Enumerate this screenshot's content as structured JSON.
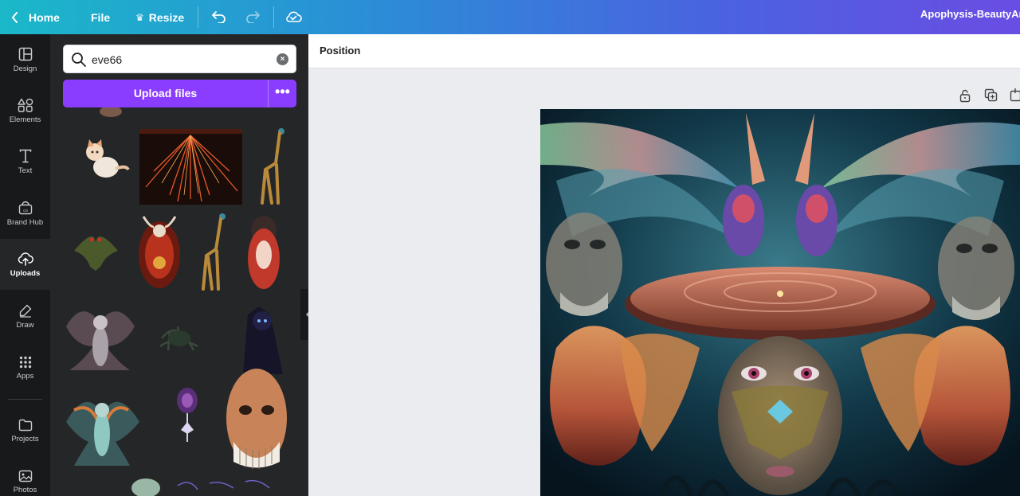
{
  "topbar": {
    "home_label": "Home",
    "file_label": "File",
    "resize_label": "Resize",
    "document_title": "Apophysis-BeautyAr"
  },
  "rail": {
    "items": [
      {
        "label": "Design",
        "icon": "layout-icon"
      },
      {
        "label": "Elements",
        "icon": "shapes-icon"
      },
      {
        "label": "Text",
        "icon": "text-icon"
      },
      {
        "label": "Brand Hub",
        "icon": "brand-icon"
      },
      {
        "label": "Uploads",
        "icon": "cloud-upload-icon",
        "active": true
      },
      {
        "label": "Draw",
        "icon": "pen-icon"
      },
      {
        "label": "Apps",
        "icon": "grid-icon"
      },
      {
        "label": "Projects",
        "icon": "folder-icon"
      },
      {
        "label": "Photos",
        "icon": "photo-icon"
      }
    ]
  },
  "panel": {
    "search_value": "eve66",
    "upload_label": "Upload files",
    "more_label": "•••",
    "thumbnails": [
      "cat",
      "fireworks",
      "giraffe",
      "winged-creature",
      "beetle",
      "giraffe-2",
      "red-figure",
      "fairy",
      "plant",
      "dark-figure",
      "fairy-2",
      "purple-flower",
      "skull-face"
    ]
  },
  "editor": {
    "toolbar_label": "Position"
  },
  "colors": {
    "accent": "#8b3dff",
    "rail_bg": "#18191b",
    "panel_bg": "#252627"
  }
}
